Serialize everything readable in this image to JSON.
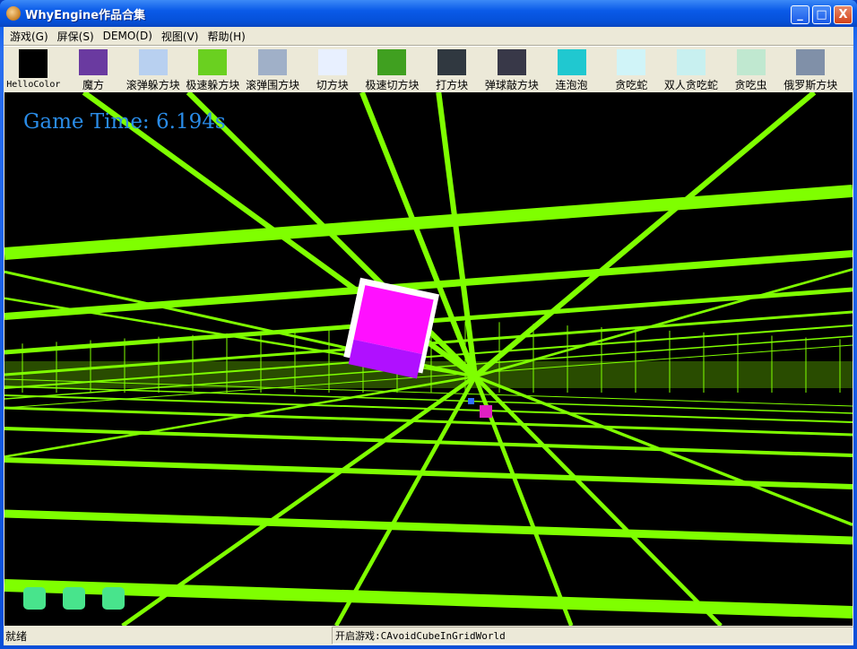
{
  "window": {
    "title": "WhyEngine作品合集",
    "minimize": "_",
    "maximize": "□",
    "close": "X"
  },
  "menu": [
    "游戏(G)",
    "屏保(S)",
    "DEMO(D)",
    "视图(V)",
    "帮助(H)"
  ],
  "toolbar": [
    {
      "label": "HelloColor",
      "color": "#000000"
    },
    {
      "label": "魔方",
      "color": "#6a3aa0"
    },
    {
      "label": "滚弹躲方块",
      "color": "#b8d0f0"
    },
    {
      "label": "极速躲方块",
      "color": "#6ad020"
    },
    {
      "label": "滚弹围方块",
      "color": "#a0b0c8"
    },
    {
      "label": "切方块",
      "color": "#e8f0ff"
    },
    {
      "label": "极速切方块",
      "color": "#40a020"
    },
    {
      "label": "打方块",
      "color": "#303840"
    },
    {
      "label": "弹球敲方块",
      "color": "#383848"
    },
    {
      "label": "连泡泡",
      "color": "#20c8d0"
    },
    {
      "label": "贪吃蛇",
      "color": "#d0f4f8"
    },
    {
      "label": "双人贪吃蛇",
      "color": "#c8f0f0"
    },
    {
      "label": "贪吃虫",
      "color": "#c0e8d0"
    },
    {
      "label": "俄罗斯方块",
      "color": "#8090a8"
    }
  ],
  "game": {
    "time_label": "Game Time: 6.194s",
    "lives": 3,
    "grid_color": "#7fff00",
    "cube_color": "#ff10ff"
  },
  "status": {
    "left": "就绪",
    "right": "开启游戏:CAvoidCubeInGridWorld"
  }
}
